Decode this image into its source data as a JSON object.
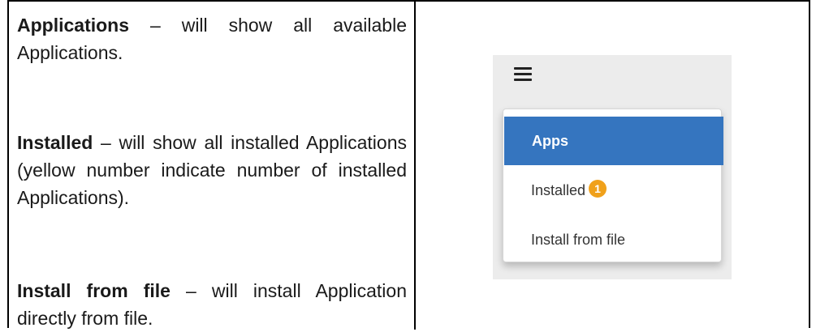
{
  "descriptions": [
    {
      "term": "Applications",
      "text": " – will show all available Applications."
    },
    {
      "term": "Installed",
      "text": " – will show all installed Applications (yellow number indicate number of installed Applications)."
    },
    {
      "term": "Install from file",
      "text": " – will install Application directly from file."
    }
  ],
  "menu": {
    "items": [
      {
        "label": "Apps",
        "active": true
      },
      {
        "label": "Installed",
        "badge": "1"
      },
      {
        "label": "Install from file"
      }
    ]
  },
  "colors": {
    "active_item": "#3575bf",
    "badge": "#f0a11b"
  },
  "icons": {
    "menu_toggle": "hamburger-menu-icon"
  }
}
